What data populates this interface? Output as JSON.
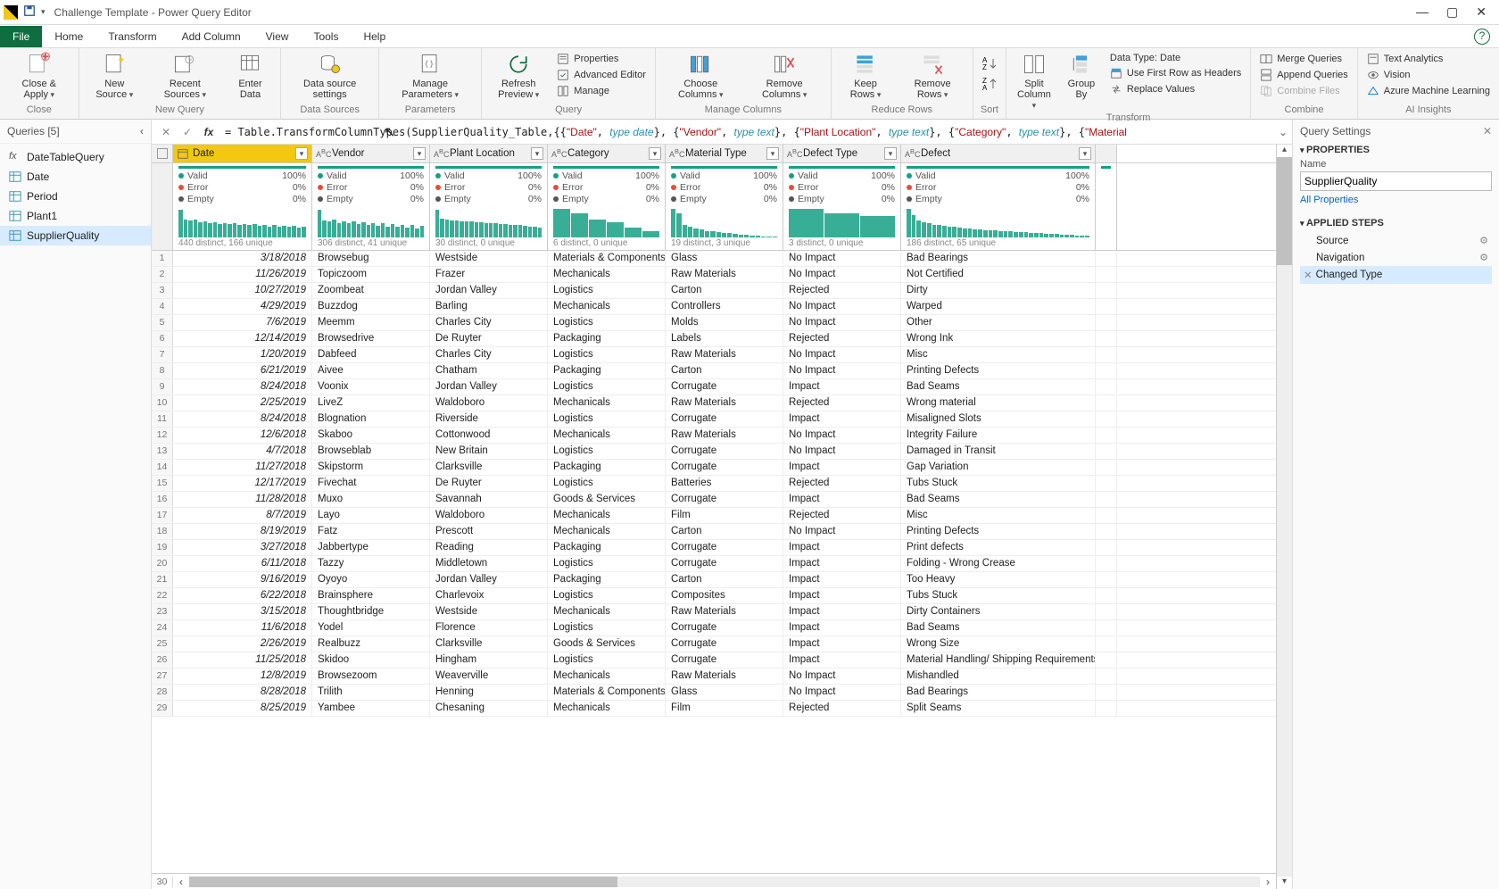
{
  "window": {
    "title": "Challenge Template - Power Query Editor",
    "controls": {
      "min": "—",
      "max": "▢",
      "close": "✕"
    }
  },
  "menutabs": [
    "File",
    "Home",
    "Transform",
    "Add Column",
    "View",
    "Tools",
    "Help"
  ],
  "ribbon": {
    "close": {
      "closeApply": "Close &\nApply",
      "group": "Close"
    },
    "newquery": {
      "newSource": "New\nSource",
      "recent": "Recent\nSources",
      "enter": "Enter\nData",
      "group": "New Query"
    },
    "datasources": {
      "btn": "Data source\nsettings",
      "group": "Data Sources"
    },
    "parameters": {
      "btn": "Manage\nParameters",
      "group": "Parameters"
    },
    "query": {
      "refresh": "Refresh\nPreview",
      "props": "Properties",
      "adv": "Advanced Editor",
      "manage": "Manage",
      "group": "Query"
    },
    "managecols": {
      "choose": "Choose\nColumns",
      "remove": "Remove\nColumns",
      "group": "Manage Columns"
    },
    "reducerows": {
      "keep": "Keep\nRows",
      "removerows": "Remove\nRows",
      "group": "Reduce Rows"
    },
    "sort": {
      "group": "Sort"
    },
    "transform": {
      "split": "Split\nColumn",
      "group": "Group\nBy",
      "datatype": "Data Type: Date",
      "firstrow": "Use First Row as Headers",
      "replace": "Replace Values",
      "glabel": "Transform"
    },
    "combine": {
      "merge": "Merge Queries",
      "append": "Append Queries",
      "combine": "Combine Files",
      "group": "Combine"
    },
    "ai": {
      "text": "Text Analytics",
      "vision": "Vision",
      "aml": "Azure Machine Learning",
      "group": "AI Insights"
    }
  },
  "queriesPane": {
    "header": "Queries [5]",
    "items": [
      {
        "name": "DateTableQuery",
        "type": "fx"
      },
      {
        "name": "Date",
        "type": "table"
      },
      {
        "name": "Period",
        "type": "table"
      },
      {
        "name": "Plant1",
        "type": "table"
      },
      {
        "name": "SupplierQuality",
        "type": "table",
        "selected": true
      }
    ]
  },
  "formula": {
    "prefix": "= Table.TransformColumnTypes(SupplierQuality_Table,{{",
    "segments": [
      {
        "str": "\"Date\"",
        "typ": "type date"
      },
      {
        "str": "\"Vendor\"",
        "typ": "type text"
      },
      {
        "str": "\"Plant Location\"",
        "typ": "type text"
      },
      {
        "str": "\"Category\"",
        "typ": "type text"
      },
      {
        "str": "\"Material",
        "typ": ""
      }
    ]
  },
  "columns": [
    {
      "name": "Date",
      "cls": "col-date",
      "sel": true,
      "type": "date",
      "valid": "100%",
      "error": "0%",
      "empty": "0%",
      "distinct": "440 distinct, 166 unique",
      "spark": [
        90,
        60,
        55,
        58,
        50,
        52,
        48,
        50,
        45,
        48,
        44,
        46,
        42,
        45,
        40,
        43,
        38,
        42,
        36,
        40,
        35,
        38,
        34,
        37,
        33,
        36
      ]
    },
    {
      "name": "Vendor",
      "cls": "col-vendor",
      "type": "text",
      "valid": "100%",
      "error": "0%",
      "empty": "0%",
      "distinct": "306 distinct, 41 unique",
      "spark": [
        90,
        55,
        52,
        58,
        48,
        54,
        46,
        52,
        44,
        50,
        40,
        48,
        38,
        46,
        36,
        44,
        34,
        42,
        32,
        40,
        30,
        38
      ]
    },
    {
      "name": "Plant Location",
      "cls": "col-plant",
      "type": "text",
      "valid": "100%",
      "error": "0%",
      "empty": "0%",
      "distinct": "30 distinct, 0 unique",
      "spark": [
        90,
        62,
        58,
        56,
        55,
        54,
        53,
        52,
        51,
        50,
        48,
        47,
        46,
        45,
        44,
        42,
        41,
        40,
        38,
        36,
        34,
        32
      ]
    },
    {
      "name": "Category",
      "cls": "col-category",
      "type": "text",
      "valid": "100%",
      "error": "0%",
      "empty": "0%",
      "distinct": "6 distinct, 0 unique",
      "spark": [
        95,
        78,
        60,
        50,
        32,
        20
      ]
    },
    {
      "name": "Material Type",
      "cls": "col-material",
      "type": "text",
      "valid": "100%",
      "error": "0%",
      "empty": "0%",
      "distinct": "19 distinct, 3 unique",
      "spark": [
        95,
        80,
        40,
        35,
        30,
        26,
        22,
        20,
        18,
        16,
        14,
        12,
        10,
        8,
        6,
        5,
        4,
        3,
        2
      ]
    },
    {
      "name": "Defect Type",
      "cls": "col-deftype",
      "type": "text",
      "valid": "100%",
      "error": "0%",
      "empty": "0%",
      "distinct": "3 distinct, 0 unique",
      "spark": [
        95,
        80,
        70
      ]
    },
    {
      "name": "Defect",
      "cls": "col-defect",
      "type": "text",
      "valid": "100%",
      "error": "0%",
      "empty": "0%",
      "distinct": "186 distinct, 65 unique",
      "spark": [
        95,
        75,
        55,
        50,
        46,
        42,
        40,
        38,
        36,
        34,
        32,
        30,
        28,
        27,
        26,
        25,
        24,
        23,
        22,
        21,
        20,
        19,
        18,
        17,
        16,
        15,
        14,
        13,
        12,
        11,
        10,
        9,
        8,
        7,
        6,
        5
      ]
    }
  ],
  "rows": [
    [
      "3/18/2018",
      "Browsebug",
      "Westside",
      "Materials & Components",
      "Glass",
      "No Impact",
      "Bad Bearings"
    ],
    [
      "11/26/2019",
      "Topiczoom",
      "Frazer",
      "Mechanicals",
      "Raw Materials",
      "No Impact",
      "Not Certified"
    ],
    [
      "10/27/2019",
      "Zoombeat",
      "Jordan Valley",
      "Logistics",
      "Carton",
      "Rejected",
      "Dirty"
    ],
    [
      "4/29/2019",
      "Buzzdog",
      "Barling",
      "Mechanicals",
      "Controllers",
      "No Impact",
      "Warped"
    ],
    [
      "7/6/2019",
      "Meemm",
      "Charles City",
      "Logistics",
      "Molds",
      "No Impact",
      "Other"
    ],
    [
      "12/14/2019",
      "Browsedrive",
      "De Ruyter",
      "Packaging",
      "Labels",
      "Rejected",
      "Wrong Ink"
    ],
    [
      "1/20/2019",
      "Dabfeed",
      "Charles City",
      "Logistics",
      "Raw Materials",
      "No Impact",
      "Misc"
    ],
    [
      "6/21/2019",
      "Aivee",
      "Chatham",
      "Packaging",
      "Carton",
      "No Impact",
      "Printing Defects"
    ],
    [
      "8/24/2018",
      "Voonix",
      "Jordan Valley",
      "Logistics",
      "Corrugate",
      "Impact",
      "Bad Seams"
    ],
    [
      "2/25/2019",
      "LiveZ",
      "Waldoboro",
      "Mechanicals",
      "Raw Materials",
      "Rejected",
      "Wrong material"
    ],
    [
      "8/24/2018",
      "Blognation",
      "Riverside",
      "Logistics",
      "Corrugate",
      "Impact",
      "Misaligned Slots"
    ],
    [
      "12/6/2018",
      "Skaboo",
      "Cottonwood",
      "Mechanicals",
      "Raw Materials",
      "No Impact",
      "Integrity Failure"
    ],
    [
      "4/7/2018",
      "Browseblab",
      "New Britain",
      "Logistics",
      "Corrugate",
      "No Impact",
      "Damaged in Transit"
    ],
    [
      "11/27/2018",
      "Skipstorm",
      "Clarksville",
      "Packaging",
      "Corrugate",
      "Impact",
      "Gap Variation"
    ],
    [
      "12/17/2019",
      "Fivechat",
      "De Ruyter",
      "Logistics",
      "Batteries",
      "Rejected",
      "Tubs Stuck"
    ],
    [
      "11/28/2018",
      "Muxo",
      "Savannah",
      "Goods & Services",
      "Corrugate",
      "Impact",
      "Bad Seams"
    ],
    [
      "8/7/2019",
      "Layo",
      "Waldoboro",
      "Mechanicals",
      "Film",
      "Rejected",
      "Misc"
    ],
    [
      "8/19/2019",
      "Fatz",
      "Prescott",
      "Mechanicals",
      "Carton",
      "No Impact",
      "Printing Defects"
    ],
    [
      "3/27/2018",
      "Jabbertype",
      "Reading",
      "Packaging",
      "Corrugate",
      "Impact",
      "Print defects"
    ],
    [
      "6/11/2018",
      "Tazzy",
      "Middletown",
      "Logistics",
      "Corrugate",
      "Impact",
      "Folding - Wrong Crease"
    ],
    [
      "9/16/2019",
      "Oyoyo",
      "Jordan Valley",
      "Packaging",
      "Carton",
      "Impact",
      "Too Heavy"
    ],
    [
      "6/22/2018",
      "Brainsphere",
      "Charlevoix",
      "Logistics",
      "Composites",
      "Impact",
      "Tubs Stuck"
    ],
    [
      "3/15/2018",
      "Thoughtbridge",
      "Westside",
      "Mechanicals",
      "Raw Materials",
      "Impact",
      "Dirty Containers"
    ],
    [
      "11/6/2018",
      "Yodel",
      "Florence",
      "Logistics",
      "Corrugate",
      "Impact",
      "Bad Seams"
    ],
    [
      "2/26/2019",
      "Realbuzz",
      "Clarksville",
      "Goods & Services",
      "Corrugate",
      "Impact",
      "Wrong Size"
    ],
    [
      "11/25/2018",
      "Skidoo",
      "Hingham",
      "Logistics",
      "Corrugate",
      "Impact",
      "Material Handling/ Shipping Requirements Error"
    ],
    [
      "12/8/2019",
      "Browsezoom",
      "Weaverville",
      "Mechanicals",
      "Raw Materials",
      "No Impact",
      "Mishandled"
    ],
    [
      "8/28/2018",
      "Trilith",
      "Henning",
      "Materials & Components",
      "Glass",
      "No Impact",
      "Bad Bearings"
    ],
    [
      "8/25/2019",
      "Yambee",
      "Chesaning",
      "Mechanicals",
      "Film",
      "Rejected",
      "Split Seams"
    ]
  ],
  "settings": {
    "header": "Query Settings",
    "propTitle": "PROPERTIES",
    "nameLabel": "Name",
    "nameValue": "SupplierQuality",
    "allProps": "All Properties",
    "stepsTitle": "APPLIED STEPS",
    "steps": [
      {
        "name": "Source",
        "gear": true
      },
      {
        "name": "Navigation",
        "gear": true
      },
      {
        "name": "Changed Type",
        "gear": false,
        "sel": true
      }
    ]
  },
  "labels": {
    "valid": "Valid",
    "error": "Error",
    "empty": "Empty"
  }
}
